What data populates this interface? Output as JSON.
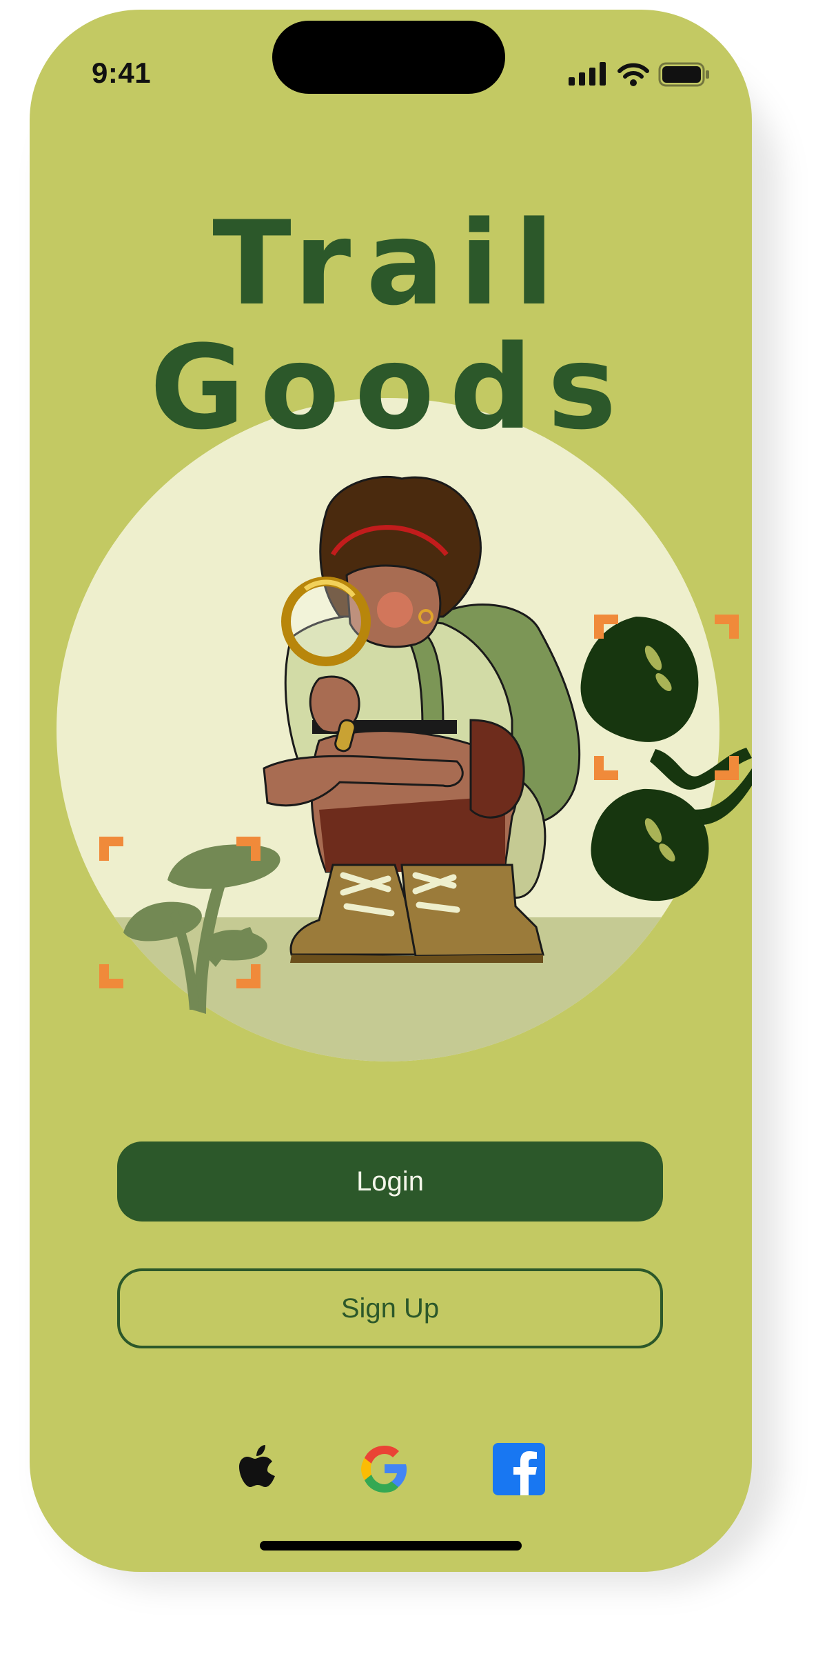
{
  "status_bar": {
    "time": "9:41"
  },
  "brand": {
    "title_line_1": "Trail",
    "title_line_2": "Goods"
  },
  "actions": {
    "login_label": "Login",
    "signup_label": "Sign Up"
  },
  "social_login": [
    {
      "provider": "Apple",
      "icon": "apple-icon"
    },
    {
      "provider": "Google",
      "icon": "google-icon"
    },
    {
      "provider": "Facebook",
      "icon": "facebook-icon"
    }
  ],
  "colors": {
    "background": "#c3c963",
    "primary": "#2c582a",
    "circle": "#eeefcd",
    "focus_corners": "#f08a3a"
  }
}
